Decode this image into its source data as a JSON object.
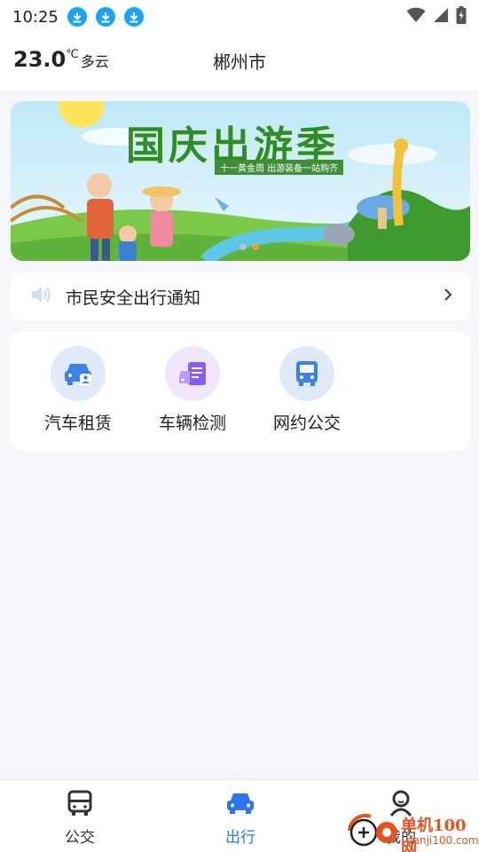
{
  "status_bar": {
    "time": "10:25",
    "download_icons": [
      "download-icon",
      "download-icon",
      "download-icon"
    ],
    "right_icons": [
      "wifi-icon",
      "signal-icon",
      "battery-charging-icon"
    ]
  },
  "header": {
    "temperature": "23.0",
    "temperature_unit": "℃",
    "condition": "多云",
    "city": "郴州市"
  },
  "banner": {
    "title": "国庆出游季",
    "subtitle": "十一黄金周 出游装备一站购齐",
    "page_count": 2,
    "active_index": 1
  },
  "notice": {
    "icon": "speaker-icon",
    "text": "市民安全出行通知",
    "arrow": "chevron-right-icon"
  },
  "services": [
    {
      "label": "汽车租赁",
      "icon": "car-rental-icon",
      "bg": "#dfe9f8",
      "color": "#3b82e8"
    },
    {
      "label": "车辆检测",
      "icon": "vehicle-inspection-icon",
      "bg": "#efe6fb",
      "color": "#8b5cf0"
    },
    {
      "label": "网约公交",
      "icon": "bus-icon",
      "bg": "#dfe9f8",
      "color": "#3b82e8"
    }
  ],
  "bottom_nav": [
    {
      "label": "公交",
      "icon": "bus-icon",
      "active": false
    },
    {
      "label": "出行",
      "icon": "car-icon",
      "active": true
    },
    {
      "label": "我的",
      "icon": "user-icon",
      "active": false
    }
  ],
  "watermark": {
    "line1": "单机100网",
    "line2": "danji100.com"
  },
  "colors": {
    "accent": "#2f74f0",
    "background": "#f4f6fa",
    "download_blue": "#1aa3f0"
  }
}
